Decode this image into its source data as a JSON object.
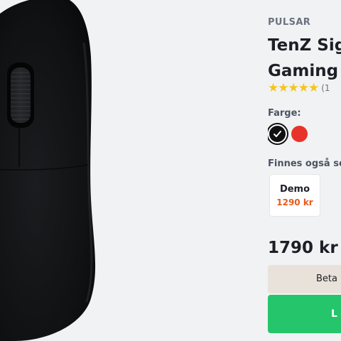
{
  "product": {
    "brand": "PULSAR",
    "title_line1": "TenZ Sig",
    "title_line2": "Gaming",
    "rating_stars": 5,
    "review_count": "(1",
    "price": "1790 kr"
  },
  "color": {
    "label": "Farge:",
    "options": [
      {
        "name": "black",
        "hex": "#111111",
        "selected": true
      },
      {
        "name": "red",
        "hex": "#e8332a",
        "selected": false
      }
    ]
  },
  "variants": {
    "label": "Finnes også sor",
    "items": [
      {
        "name": "Demo",
        "price": "1290 kr"
      }
    ]
  },
  "actions": {
    "pay_label": "Beta",
    "buy_label": "L"
  },
  "colors": {
    "accent_green": "#25c56b",
    "star": "#f5c518",
    "sale_orange": "#e8591a",
    "pay_bg": "#e8e2db"
  }
}
